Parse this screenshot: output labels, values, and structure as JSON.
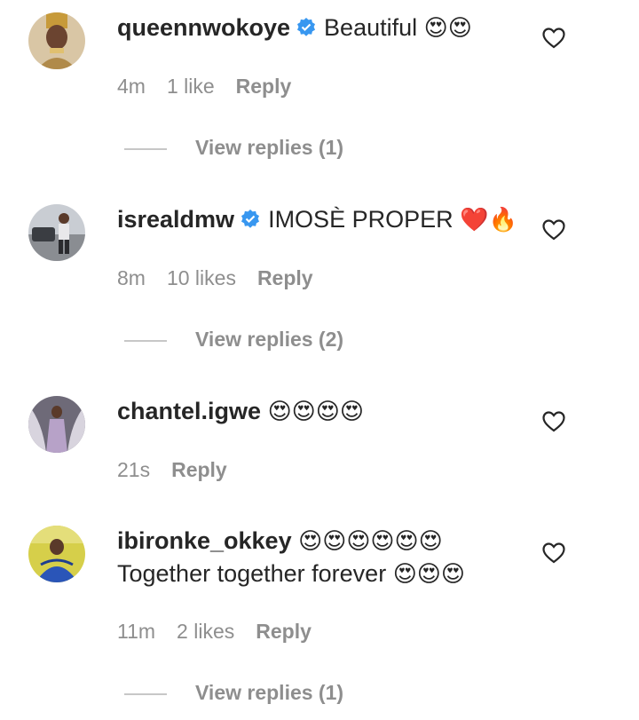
{
  "comments": [
    {
      "username": "queennwokoye",
      "verified": true,
      "text": "Beautiful",
      "emojis": "😍😍",
      "time": "4m",
      "likes": "1 like",
      "reply_label": "Reply",
      "view_replies": "View replies (1)"
    },
    {
      "username": "isrealdmw",
      "verified": true,
      "text": "IMOSÈ PROPER",
      "emojis": "❤️🔥",
      "time": "8m",
      "likes": "10 likes",
      "reply_label": "Reply",
      "view_replies": "View replies (2)"
    },
    {
      "username": "chantel.igwe",
      "verified": false,
      "text": "",
      "emojis": "😍😍😍😍",
      "time": "21s",
      "reply_label": "Reply"
    },
    {
      "username": "ibironke_okkey",
      "verified": false,
      "text": "",
      "emojis": "😍😍😍😍😍😍",
      "line2_text": "Together together forever",
      "line2_emojis": "😍😍😍",
      "time": "11m",
      "likes": "2 likes",
      "reply_label": "Reply",
      "view_replies": "View replies (1)"
    }
  ],
  "icons": {
    "like": "heart-outline-icon",
    "verified": "verified-badge-icon"
  },
  "colors": {
    "verified": "#3897f0",
    "secondary_text": "#8e8e8e",
    "primary_text": "#262626"
  }
}
